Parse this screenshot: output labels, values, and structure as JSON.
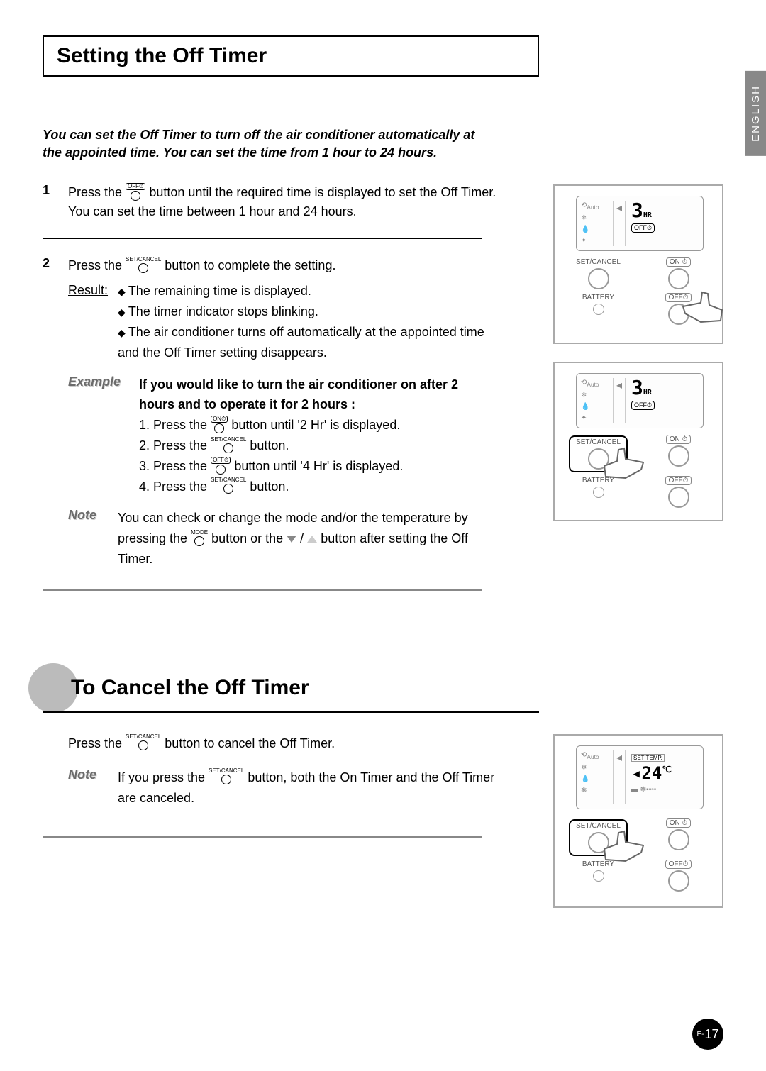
{
  "language_tab": "ENGLISH",
  "title": "Setting the Off Timer",
  "intro": "You can set the Off Timer to turn off the air conditioner automatically at the appointed time. You can set the time from 1 hour to 24 hours.",
  "step1": {
    "num": "1",
    "text_a": "Press the ",
    "btn_label": "OFF⏱",
    "text_b": " button until the required time is displayed to set the Off Timer. You can set the time between 1 hour and 24 hours."
  },
  "step2": {
    "num": "2",
    "text_a": "Press the ",
    "btn_label": "SET/CANCEL",
    "text_b": " button to complete the setting.",
    "result_label": "Result:",
    "results": [
      "The remaining time is displayed.",
      "The timer indicator stops blinking.",
      "The air conditioner turns off automatically at the appointed time and the Off Timer setting disappears."
    ]
  },
  "example": {
    "label": "Example",
    "bold": "If you would like to turn the air conditioner on after 2 hours and to operate it for 2 hours :",
    "lines": {
      "l1a": "1. Press the ",
      "l1btn": "ON⏱",
      "l1b": " button until '2 Hr' is displayed.",
      "l2a": "2. Press the ",
      "l2btn": "SET/CANCEL",
      "l2b": " button.",
      "l3a": "3. Press the ",
      "l3btn": "OFF⏱",
      "l3b": " button until '4 Hr' is displayed.",
      "l4a": "4. Press the ",
      "l4btn": "SET/CANCEL",
      "l4b": " button."
    }
  },
  "note1": {
    "label": "Note",
    "text_a": "You can check or change the mode and/or the temperature by pressing the ",
    "btn_mode": "MODE",
    "text_b": " button or the ",
    "text_c": " button after setting the Off Timer."
  },
  "section2_title": "To Cancel the Off Timer",
  "cancel": {
    "text_a": "Press the ",
    "btn": "SET/CANCEL",
    "text_b": " button to cancel the Off Timer."
  },
  "note2": {
    "label": "Note",
    "text_a": "If you press the ",
    "btn": "SET/CANCEL",
    "text_b": " button,  both the On Timer and the Off Timer are canceled."
  },
  "remote": {
    "hr_display": "3",
    "hr_unit": "HR",
    "off_label": "OFF⏱",
    "set_cancel": "SET/CANCEL",
    "on_btn": "ON ⏱",
    "off_btn": "OFF⏱",
    "battery": "BATTERY",
    "set_temp": "SET TEMP.",
    "temp": "24",
    "temp_unit": "℃",
    "auto": "Auto"
  },
  "page": {
    "prefix": "E-",
    "num": "17"
  }
}
